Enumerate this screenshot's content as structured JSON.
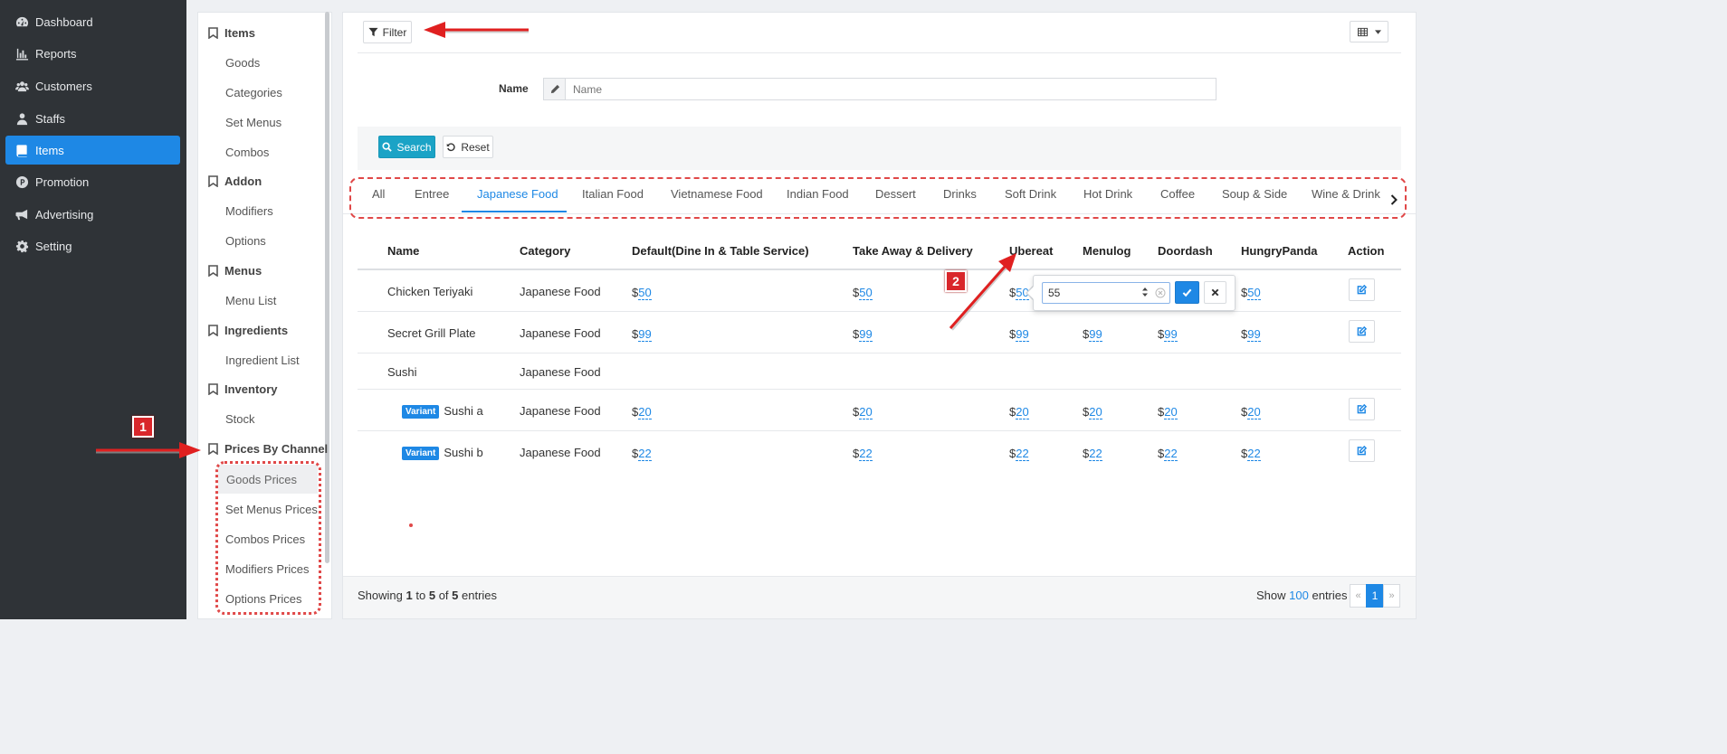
{
  "nav": {
    "items": [
      {
        "label": "Dashboard",
        "icon": "dashboard-icon"
      },
      {
        "label": "Reports",
        "icon": "bar-chart-icon"
      },
      {
        "label": "Customers",
        "icon": "users-icon"
      },
      {
        "label": "Staffs",
        "icon": "user-tie-icon"
      },
      {
        "label": "Items",
        "icon": "book-icon"
      },
      {
        "label": "Promotion",
        "icon": "promotion-p-icon"
      },
      {
        "label": "Advertising",
        "icon": "megaphone-icon"
      },
      {
        "label": "Setting",
        "icon": "gear-icon"
      }
    ],
    "active_color": "#1e88e5"
  },
  "submenu": {
    "sections": [
      {
        "title": "Items",
        "items": [
          "Goods",
          "Categories",
          "Set Menus",
          "Combos"
        ]
      },
      {
        "title": "Addon",
        "items": [
          "Modifiers",
          "Options"
        ]
      },
      {
        "title": "Menus",
        "items": [
          "Menu List"
        ]
      },
      {
        "title": "Ingredients",
        "items": [
          "Ingredient List"
        ]
      },
      {
        "title": "Inventory",
        "items": [
          "Stock"
        ]
      },
      {
        "title": "Prices By Channel",
        "items": [
          "Goods Prices",
          "Set Menus Prices",
          "Combos Prices",
          "Modifiers Prices",
          "Options Prices"
        ]
      }
    ]
  },
  "toolbar": {
    "filter_label": "Filter"
  },
  "search": {
    "name_label": "Name",
    "name_placeholder": "Name",
    "search_label": "Search",
    "reset_label": "Reset"
  },
  "tabs": [
    "All",
    "Entree",
    "Japanese Food",
    "Italian Food",
    "Vietnamese Food",
    "Indian Food",
    "Dessert",
    "Drinks",
    "Soft Drink",
    "Hot Drink",
    "Coffee",
    "Soup & Side",
    "Wine & Drink"
  ],
  "active_tab": "Japanese Food",
  "table": {
    "headers": [
      "Name",
      "Category",
      "Default(Dine In & Table Service)",
      "Take Away & Delivery",
      "Ubereat",
      "Menulog",
      "Doordash",
      "HungryPanda",
      "Action"
    ],
    "rows": [
      {
        "name": "Chicken Teriyaki",
        "variant": "",
        "category": "Japanese Food",
        "prices": [
          "50",
          "50",
          "50",
          "",
          "",
          "50"
        ],
        "editable": true
      },
      {
        "name": "Secret Grill Plate",
        "variant": "",
        "category": "Japanese Food",
        "prices": [
          "99",
          "99",
          "99",
          "99",
          "99",
          "99"
        ],
        "editable": true
      },
      {
        "name": "Sushi",
        "variant": "",
        "category": "Japanese Food",
        "prices": [
          "",
          "",
          "",
          "",
          "",
          ""
        ],
        "editable": false
      },
      {
        "name": "Sushi a",
        "variant": "Variant",
        "category": "Japanese Food",
        "prices": [
          "20",
          "20",
          "20",
          "20",
          "20",
          "20"
        ],
        "editable": true
      },
      {
        "name": "Sushi b",
        "variant": "Variant",
        "category": "Japanese Food",
        "prices": [
          "22",
          "22",
          "22",
          "22",
          "22",
          "22"
        ],
        "editable": true
      }
    ],
    "currency": "$"
  },
  "popover": {
    "input_value": "55"
  },
  "footer": {
    "showing_prefix": "Showing",
    "from": "1",
    "to_word": "to",
    "to": "5",
    "of_word": "of",
    "total": "5",
    "entries_word": "entries",
    "show_label": "Show",
    "page_size": "100",
    "entries_suffix": "entries",
    "prev": "«",
    "page": "1",
    "next": "»"
  },
  "annotations": {
    "callout_1": "1",
    "callout_2": "2"
  }
}
